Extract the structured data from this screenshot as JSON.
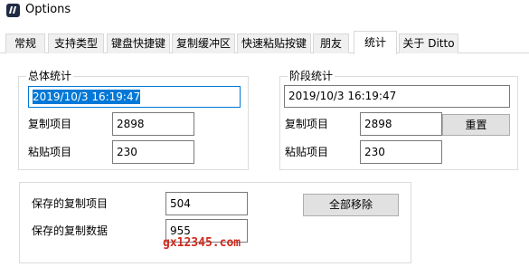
{
  "window": {
    "title": "Options"
  },
  "tabs": [
    {
      "label": "常规"
    },
    {
      "label": "支持类型"
    },
    {
      "label": "键盘快捷键"
    },
    {
      "label": "复制缓冲区"
    },
    {
      "label": "快速粘贴按键"
    },
    {
      "label": "朋友"
    },
    {
      "label": "统计"
    },
    {
      "label": "关于 Ditto"
    }
  ],
  "total_stats": {
    "legend": "总体统计",
    "date": "2019/10/3 16:19:47",
    "copy_label": "复制项目",
    "copy_value": "2898",
    "paste_label": "粘贴项目",
    "paste_value": "230"
  },
  "stage_stats": {
    "legend": "阶段统计",
    "date": "2019/10/3 16:19:47",
    "copy_label": "复制项目",
    "copy_value": "2898",
    "reset_label": "重置",
    "paste_label": "粘贴项目",
    "paste_value": "230"
  },
  "saved": {
    "items_label": "保存的复制项目",
    "items_value": "504",
    "data_label": "保存的复制数据",
    "data_value": "955",
    "remove_all_label": "全部移除"
  },
  "watermark": "gx12345.com"
}
